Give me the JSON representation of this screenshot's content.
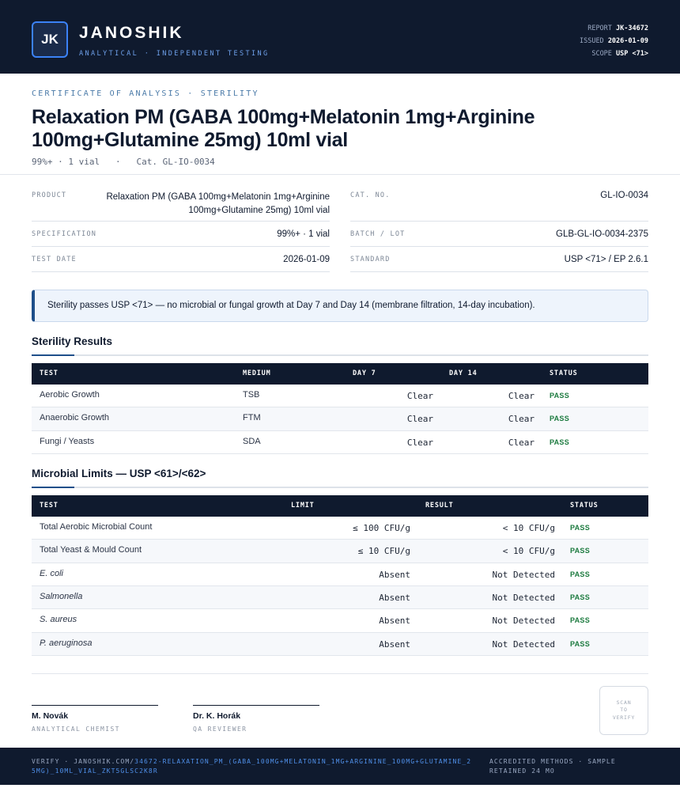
{
  "header": {
    "logo_initials": "JK",
    "brand": "JANOSHIK",
    "tagline": "ANALYTICAL · INDEPENDENT TESTING",
    "report_label": "REPORT",
    "report_value": "JK-34672",
    "issued_label": "ISSUED",
    "issued_value": "2026-01-09",
    "scope_label": "SCOPE",
    "scope_value": "USP <71>"
  },
  "title": {
    "kicker": "CERTIFICATE OF ANALYSIS · STERILITY",
    "product_name": "Relaxation PM (GABA 100mg+Melatonin 1mg+Arginine 100mg+Glutamine 25mg) 10ml vial",
    "subtitle_spec": "99%+ · 1 vial",
    "subtitle_sep": "·",
    "subtitle_cat": "Cat. GL-IO-0034"
  },
  "details": {
    "product_label": "PRODUCT",
    "product_line1": "Relaxation PM (GABA 100mg+Melatonin 1mg+Arginine",
    "product_line2": "100mg+Glutamine 25mg) 10ml vial",
    "spec_label": "SPECIFICATION",
    "spec_value": "99%+ · 1 vial",
    "date_label": "TEST DATE",
    "date_value": "2026-01-09",
    "cat_label": "CAT. NO.",
    "cat_value": "GL-IO-0034",
    "batch_label": "BATCH / LOT",
    "batch_value": "GLB-GL-IO-0034-2375",
    "standard_label": "STANDARD",
    "standard_value": "USP <71> / EP 2.6.1"
  },
  "summary": "Sterility passes USP <71> — no microbial or fungal growth at Day 7 and Day 14 (membrane filtration, 14-day incubation).",
  "sterility": {
    "heading": "Sterility Results",
    "columns": [
      "TEST",
      "MEDIUM",
      "DAY 7",
      "DAY 14",
      "STATUS"
    ],
    "rows": [
      {
        "test": "Aerobic Growth",
        "medium": "TSB",
        "day7": "Clear",
        "day14": "Clear",
        "status": "PASS"
      },
      {
        "test": "Anaerobic Growth",
        "medium": "FTM",
        "day7": "Clear",
        "day14": "Clear",
        "status": "PASS"
      },
      {
        "test": "Fungi / Yeasts",
        "medium": "SDA",
        "day7": "Clear",
        "day14": "Clear",
        "status": "PASS"
      }
    ]
  },
  "microbial": {
    "heading": "Microbial Limits — USP <61>/<62>",
    "columns": [
      "TEST",
      "LIMIT",
      "RESULT",
      "STATUS"
    ],
    "rows": [
      {
        "test": "Total Aerobic Microbial Count",
        "limit": "≤ 100 CFU/g",
        "result": "< 10 CFU/g",
        "status": "PASS"
      },
      {
        "test": "Total Yeast & Mould Count",
        "limit": "≤ 10 CFU/g",
        "result": "< 10 CFU/g",
        "status": "PASS"
      },
      {
        "test": "E. coli",
        "limit": "Absent",
        "result": "Not Detected",
        "status": "PASS"
      },
      {
        "test": "Salmonella",
        "limit": "Absent",
        "result": "Not Detected",
        "status": "PASS"
      },
      {
        "test": "S. aureus",
        "limit": "Absent",
        "result": "Not Detected",
        "status": "PASS"
      },
      {
        "test": "P. aeruginosa",
        "limit": "Absent",
        "result": "Not Detected",
        "status": "PASS"
      }
    ]
  },
  "signatures": [
    {
      "name": "M. Novák",
      "role": "ANALYTICAL CHEMIST"
    },
    {
      "name": "Dr. K. Horák",
      "role": "QA REVIEWER"
    }
  ],
  "qr": {
    "line1": "SCAN",
    "line2": "TO",
    "line3": "VERIFY"
  },
  "footer": {
    "verify_prefix": "VERIFY · JANOSHIK.COM/",
    "verify_url": "34672-RELAXATION_PM_(GABA_100MG+MELATONIN_1MG+ARGININE_100MG+GLUTAMINE_25MG)_10ML_VIAL_ZKT5GLSC2K8R",
    "right_text": "ACCREDITED METHODS · SAMPLE RETAINED 24 MO"
  },
  "colors": {
    "navy": "#0f1a2e",
    "accent_blue": "#1e4f8a",
    "pass_green": "#1b7a3e",
    "link_blue": "#4f8fe8"
  }
}
